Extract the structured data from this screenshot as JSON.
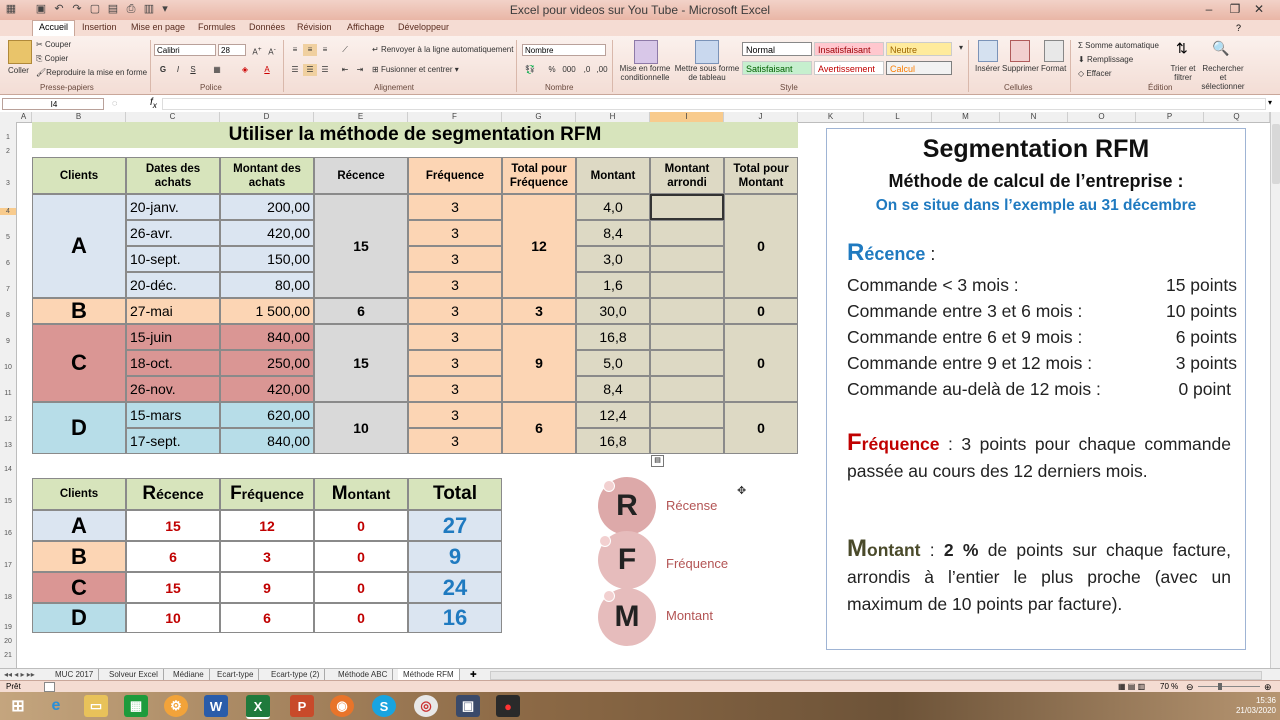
{
  "app": {
    "title": "Excel pour videos sur You Tube - Microsoft Excel"
  },
  "ribbon_tabs": [
    "Accueil",
    "Insertion",
    "Mise en page",
    "Formules",
    "Données",
    "Révision",
    "Affichage",
    "Développeur"
  ],
  "ribbon": {
    "clipboard": {
      "paste": "Coller",
      "cut": "Couper",
      "copy": "Copier",
      "format_painter": "Reproduire la mise en forme",
      "group": "Presse-papiers"
    },
    "font": {
      "name": "Calibri",
      "size": "28",
      "group": "Police"
    },
    "alignment": {
      "wrap": "Renvoyer à la ligne automatiquement",
      "merge": "Fusionner et centrer",
      "group": "Alignement"
    },
    "number": {
      "format": "Nombre",
      "group": "Nombre"
    },
    "styles": {
      "conditional": "Mise en forme conditionnelle",
      "as_table": "Mettre sous forme de tableau",
      "cells": [
        "Normal",
        "Insatisfaisant",
        "Neutre",
        "Satisfaisant",
        "Avertissement",
        "Calcul"
      ],
      "group": "Style"
    },
    "cells_group": {
      "insert": "Insérer",
      "delete": "Supprimer",
      "format": "Format",
      "group": "Cellules"
    },
    "editing": {
      "autosum": "Somme automatique",
      "fill": "Remplissage",
      "clear": "Effacer",
      "sort": "Trier et filtrer",
      "find": "Rechercher et sélectionner",
      "group": "Édition"
    }
  },
  "formula_bar": {
    "name_box": "I4",
    "formula": ""
  },
  "columns": [
    "A",
    "B",
    "C",
    "D",
    "E",
    "F",
    "G",
    "H",
    "I",
    "J",
    "K",
    "L",
    "M",
    "N",
    "O",
    "P",
    "Q"
  ],
  "rows": [
    "1",
    "2",
    "3",
    "4",
    "5",
    "6",
    "7",
    "8",
    "9",
    "10",
    "11",
    "12",
    "13",
    "14",
    "15",
    "16",
    "17",
    "18",
    "19",
    "20",
    "21"
  ],
  "sheet": {
    "title": "Utiliser la méthode de segmentation RFM",
    "headers": [
      "Clients",
      "Dates des achats",
      "Montant des achats",
      "Récence",
      "Fréquence",
      "Total pour Fréquence",
      "Montant",
      "Montant arrondi",
      "Total pour Montant"
    ],
    "clients": [
      {
        "name": "A",
        "recence": "15",
        "total_freq": "12",
        "total_montant": "0",
        "rows": [
          [
            "20-janv.",
            "200,00",
            "3",
            "4,0"
          ],
          [
            "26-avr.",
            "420,00",
            "3",
            "8,4"
          ],
          [
            "10-sept.",
            "150,00",
            "3",
            "3,0"
          ],
          [
            "20-déc.",
            "80,00",
            "3",
            "1,6"
          ]
        ]
      },
      {
        "name": "B",
        "recence": "6",
        "total_freq": "3",
        "total_montant": "0",
        "rows": [
          [
            "27-mai",
            "1 500,00",
            "3",
            "30,0"
          ]
        ]
      },
      {
        "name": "C",
        "recence": "15",
        "total_freq": "9",
        "total_montant": "0",
        "rows": [
          [
            "15-juin",
            "840,00",
            "3",
            "16,8"
          ],
          [
            "18-oct.",
            "250,00",
            "3",
            "5,0"
          ],
          [
            "26-nov.",
            "420,00",
            "3",
            "8,4"
          ]
        ]
      },
      {
        "name": "D",
        "recence": "10",
        "total_freq": "6",
        "total_montant": "0",
        "rows": [
          [
            "15-mars",
            "620,00",
            "3",
            "12,4"
          ],
          [
            "17-sept.",
            "840,00",
            "3",
            "16,8"
          ]
        ]
      }
    ],
    "summary": {
      "headers": {
        "clients": "Clients",
        "recence_cap": "R",
        "recence_rest": "écence",
        "frequence_cap": "F",
        "frequence_rest": "réquence",
        "montant_cap": "M",
        "montant_rest": "ontant",
        "total": "Total"
      },
      "rows": [
        {
          "client": "A",
          "r": "15",
          "f": "12",
          "m": "0",
          "total": "27"
        },
        {
          "client": "B",
          "r": "6",
          "f": "3",
          "m": "0",
          "total": "9"
        },
        {
          "client": "C",
          "r": "15",
          "f": "9",
          "m": "0",
          "total": "24"
        },
        {
          "client": "D",
          "r": "10",
          "f": "6",
          "m": "0",
          "total": "16"
        }
      ]
    },
    "bubbles": [
      {
        "letter": "R",
        "label": "Récense"
      },
      {
        "letter": "F",
        "label": "Fréquence"
      },
      {
        "letter": "M",
        "label": "Montant"
      }
    ]
  },
  "panel": {
    "title": "Segmentation RFM",
    "subtitle": "Méthode de calcul de l’entreprise :",
    "note": "On se situe dans l’exemple au 31 décembre",
    "recence_cap": "R",
    "recence_rest": "écence",
    "recence_colon": " :",
    "recence_rules": [
      {
        "label": "Commande < 3 mois :",
        "points": "15 points"
      },
      {
        "label": "Commande entre 3 et 6 mois :",
        "points": "10 points"
      },
      {
        "label": "Commande entre 6 et 9 mois :",
        "points": "6 points"
      },
      {
        "label": "Commande entre 9 et 12 mois :",
        "points": "3 points"
      },
      {
        "label": "Commande au-delà de 12 mois :",
        "points": "0 point"
      }
    ],
    "frequence_cap": "F",
    "frequence_rest": "réquence",
    "frequence_text": " :  3 points pour chaque commande passée au cours des 12 derniers mois.",
    "montant_cap": "M",
    "montant_rest": "ontant",
    "montant_bold": "2 %",
    "montant_text": " de points sur chaque facture, arrondis à l’entier le plus proche (avec un maximum de 10 points par facture).",
    "montant_prefix": " :  "
  },
  "sheet_tabs": [
    "MUC 2017",
    "Solveur Excel",
    "Médiane",
    "Ecart-type",
    "Ecart-type (2)",
    "Méthode ABC",
    "Méthode RFM"
  ],
  "active_sheet": "Méthode RFM",
  "status": {
    "ready": "Prêt",
    "zoom": "70 %"
  },
  "taskbar": {
    "time": "15:36",
    "date": "21/03/2020"
  }
}
